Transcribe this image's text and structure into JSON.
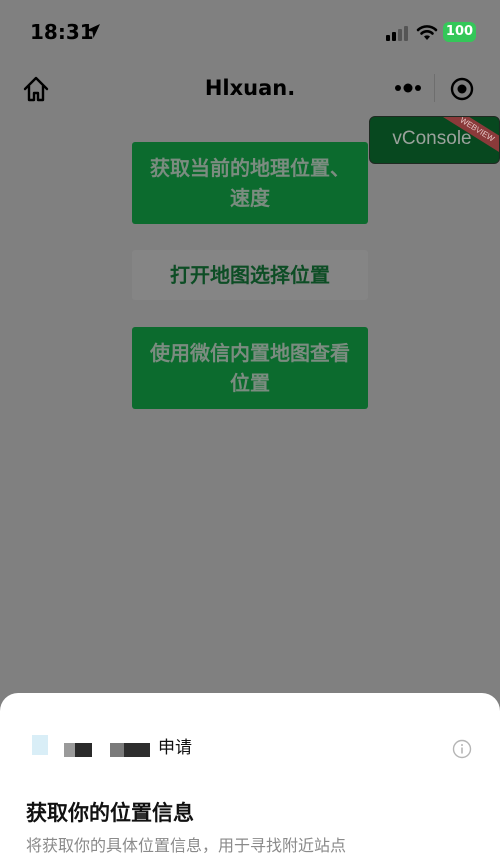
{
  "status_bar": {
    "time": "18:31",
    "battery": "100",
    "icons": [
      "location-arrow-icon",
      "signal-icon",
      "wifi-icon",
      "battery-icon"
    ],
    "battery_color": "#34c759"
  },
  "nav": {
    "title": "Hlxuan.",
    "icons": [
      "home-icon",
      "more-icon",
      "record-icon"
    ]
  },
  "vconsole": {
    "label": "vConsole",
    "ribbon": "WEBVIEW"
  },
  "buttons": [
    {
      "label": "获取当前的地理位置、速度"
    },
    {
      "label": "打开地图选择位置"
    },
    {
      "label": "使用微信内置地图查看位置"
    }
  ],
  "sheet": {
    "apply_label": "申请",
    "title": "获取你的位置信息",
    "description": "将获取你的具体位置信息，用于寻找附近站点",
    "icons": [
      "app-logo-icon",
      "info-icon"
    ]
  },
  "colors": {
    "accent_green": "#07c160",
    "overlay": "#808080"
  }
}
